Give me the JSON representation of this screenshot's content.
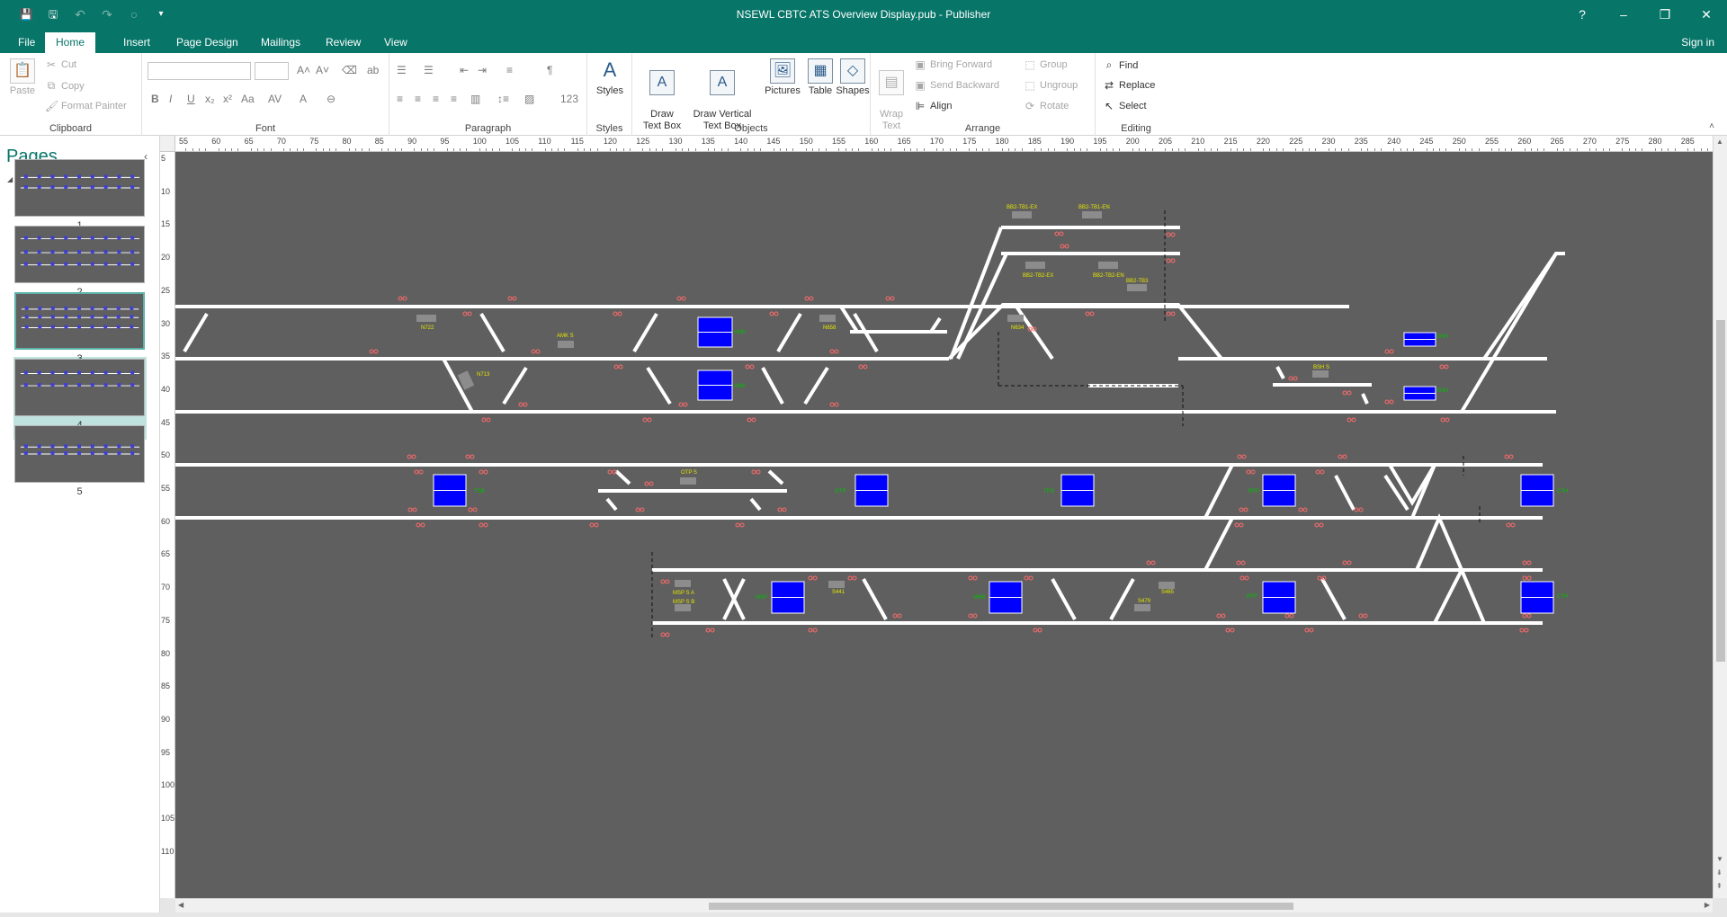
{
  "window": {
    "title": "NSEWL CBTC ATS Overview Display.pub - Publisher",
    "help": "?",
    "minimize": "–",
    "restore": "❐",
    "close": "✕"
  },
  "quick_access": {
    "save": "💾",
    "save_as": "🖫",
    "undo": "↶",
    "redo": "↷",
    "circle": "○",
    "customize": "▾"
  },
  "tabs": [
    {
      "label": "File"
    },
    {
      "label": "Home",
      "active": true
    },
    {
      "label": "Insert"
    },
    {
      "label": "Page Design"
    },
    {
      "label": "Mailings"
    },
    {
      "label": "Review"
    },
    {
      "label": "View"
    }
  ],
  "sign_in": "Sign in",
  "ribbon": {
    "clipboard": {
      "label": "Clipboard",
      "paste": "Paste",
      "cut": "Cut",
      "copy": "Copy",
      "format_painter": "Format Painter"
    },
    "font": {
      "label": "Font"
    },
    "paragraph": {
      "label": "Paragraph"
    },
    "styles": {
      "label": "Styles",
      "styles_btn": "Styles"
    },
    "objects": {
      "label": "Objects",
      "draw_text_box": "Draw\nText Box",
      "draw_vertical_text_box": "Draw Vertical\nText Box",
      "pictures": "Pictures",
      "table": "Table",
      "shapes": "Shapes"
    },
    "arrange": {
      "label": "Arrange",
      "wrap_text": "Wrap\nText",
      "bring_forward": "Bring Forward",
      "send_backward": "Send Backward",
      "align": "Align",
      "group": "Group",
      "ungroup": "Ungroup",
      "rotate": "Rotate"
    },
    "editing": {
      "label": "Editing",
      "find": "Find",
      "replace": "Replace",
      "select": "Select"
    }
  },
  "pages_panel": {
    "title": "Pages",
    "pages": [
      {
        "number": "1"
      },
      {
        "number": "2"
      },
      {
        "number": "3",
        "selected": true
      },
      {
        "number": "4"
      },
      {
        "number": "5"
      }
    ]
  },
  "hruler_labels": [
    "55",
    "60",
    "65",
    "70",
    "75",
    "80",
    "85",
    "90",
    "95",
    "100",
    "105",
    "110",
    "115",
    "120",
    "125",
    "130",
    "135",
    "140",
    "145",
    "150",
    "155",
    "160",
    "165",
    "170",
    "175",
    "180",
    "185",
    "190",
    "195",
    "200",
    "205",
    "210",
    "215",
    "220",
    "225",
    "230",
    "235",
    "240",
    "245",
    "250",
    "255",
    "260",
    "265",
    "270",
    "275",
    "280",
    "285"
  ],
  "vruler_labels": [
    "5",
    "10",
    "15",
    "20",
    "25",
    "30",
    "35",
    "40",
    "45",
    "50",
    "55",
    "60",
    "65",
    "70",
    "75",
    "80",
    "85",
    "90",
    "95",
    "100",
    "105",
    "110"
  ],
  "diagram": {
    "station_labels": [
      {
        "text": "BB2-TB1-EX"
      },
      {
        "text": "BB2-TB1-EN"
      },
      {
        "text": "BB2-TB2-EX"
      },
      {
        "text": "BB2-TB2-EN"
      },
      {
        "text": "BB2-TB3"
      },
      {
        "text": "AMK S"
      },
      {
        "text": "AMK"
      },
      {
        "text": "AMK"
      },
      {
        "text": "BSH"
      },
      {
        "text": "BSH"
      },
      {
        "text": "BSH S"
      },
      {
        "text": "OTP S"
      },
      {
        "text": "OTP"
      },
      {
        "text": "TPG"
      },
      {
        "text": "TSB"
      },
      {
        "text": "RFP"
      },
      {
        "text": "RFP"
      },
      {
        "text": "CTH"
      },
      {
        "text": "CTH"
      },
      {
        "text": "MSP S A"
      },
      {
        "text": "MSP S B"
      },
      {
        "text": "MSP"
      },
      {
        "text": "MRB"
      },
      {
        "text": "N722"
      },
      {
        "text": "N713"
      },
      {
        "text": "N658"
      },
      {
        "text": "N634"
      },
      {
        "text": "S441"
      },
      {
        "text": "S479"
      },
      {
        "text": "S465"
      }
    ],
    "colors": {
      "background": "#5f5f5f",
      "track": "#ffffff",
      "platform": "#0000ff",
      "label": "#e6e600",
      "station": "#00c000",
      "signal": "#ff6a6a"
    }
  }
}
